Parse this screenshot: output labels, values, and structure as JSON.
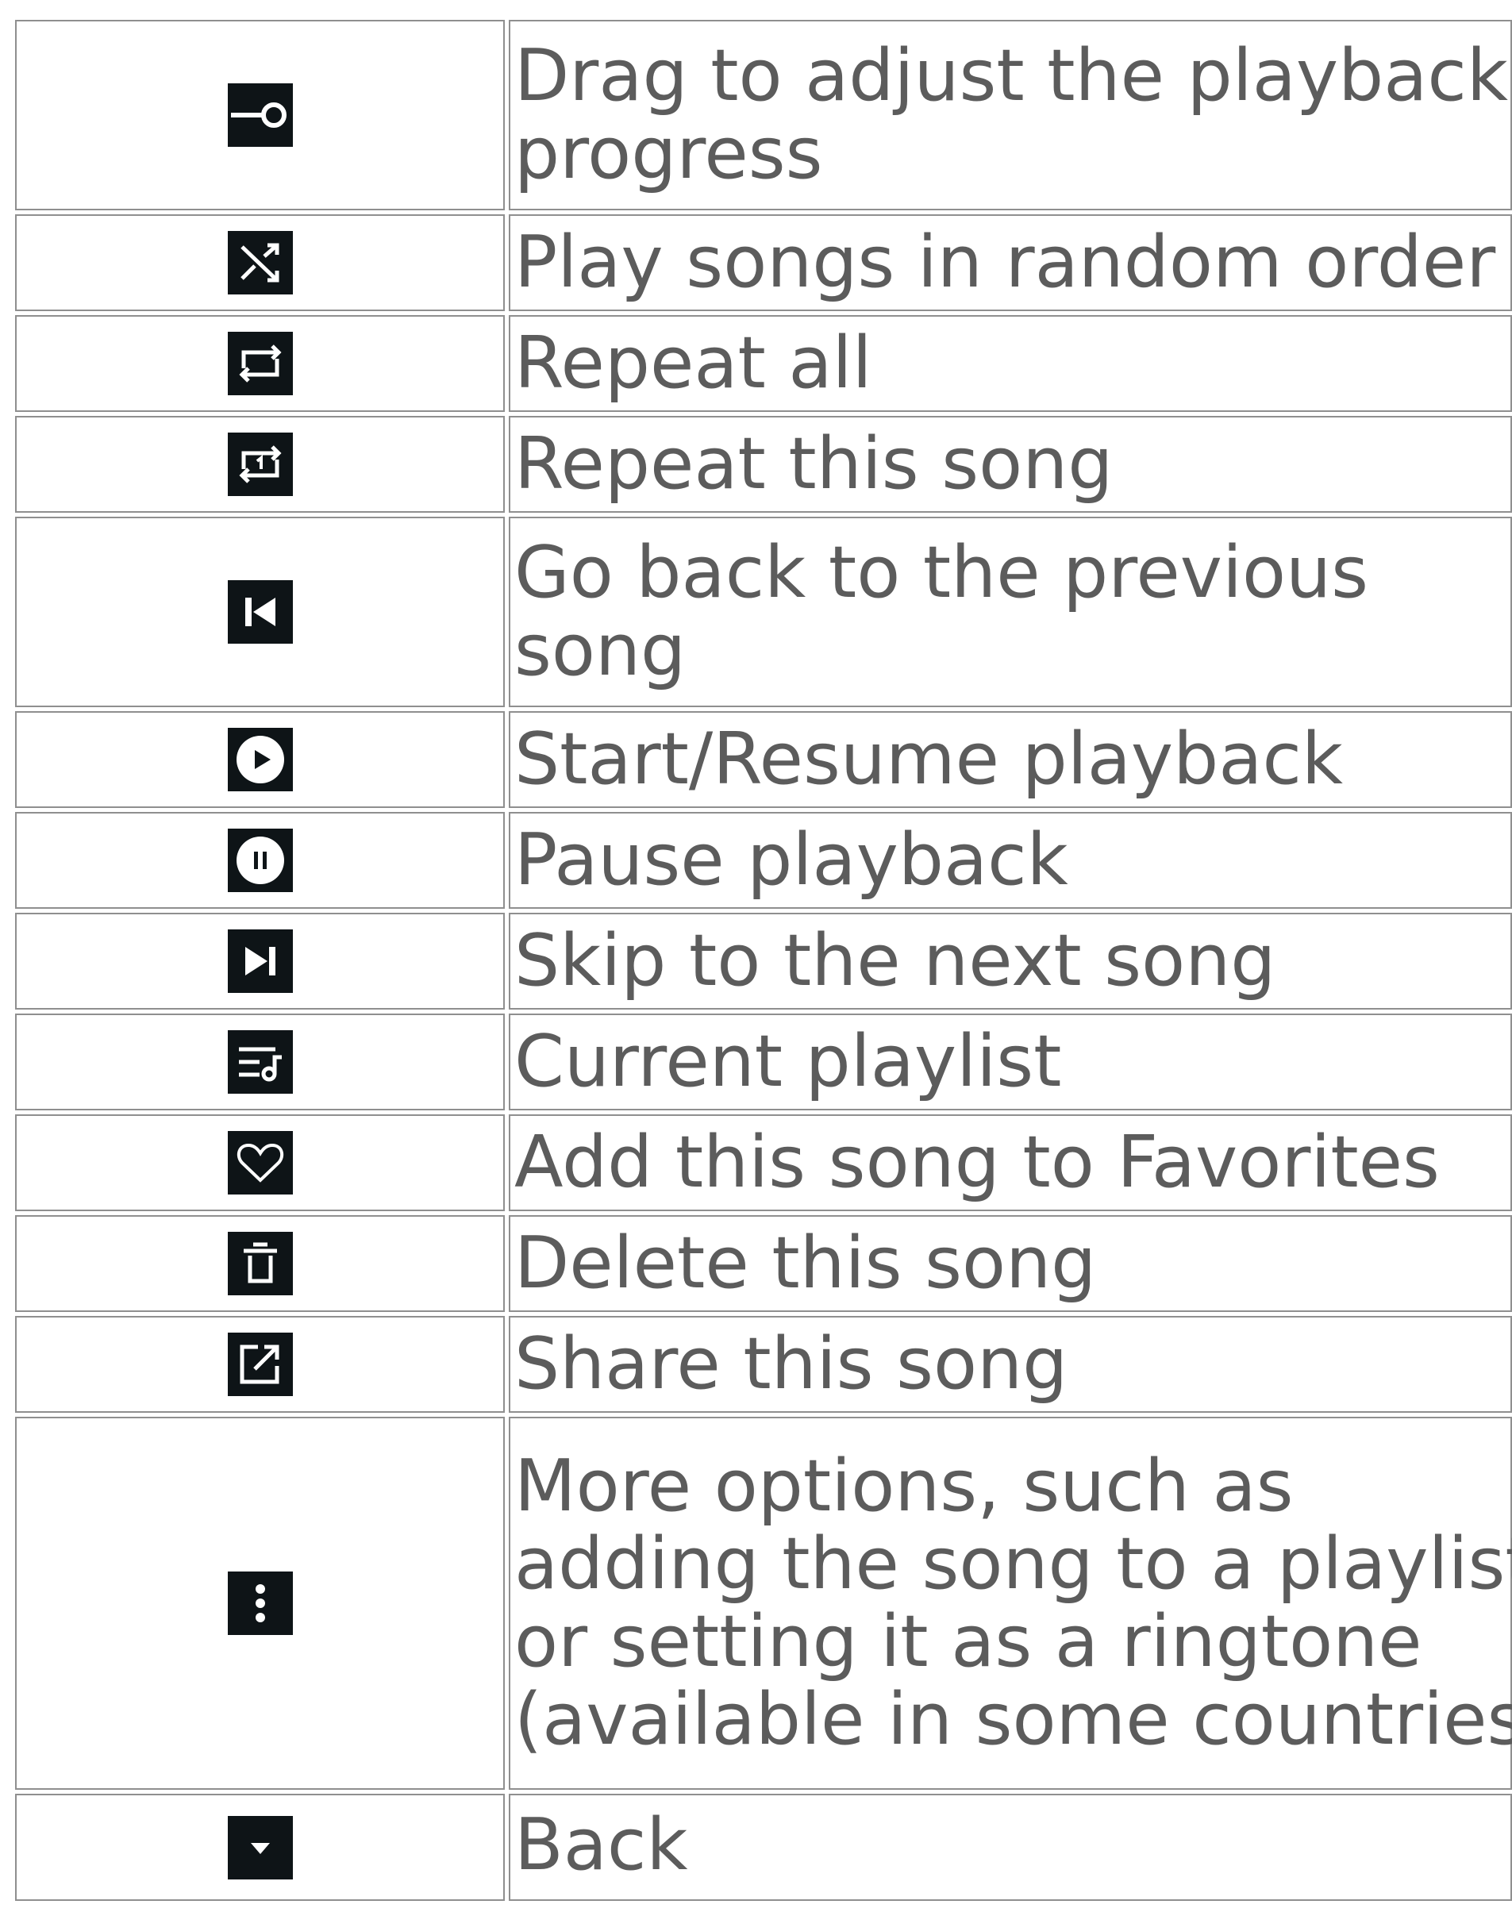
{
  "rows": [
    {
      "icon": "progress-slider-icon",
      "text": "Drag to adjust the playback\nprogress"
    },
    {
      "icon": "shuffle-icon",
      "text": "Play songs in random order"
    },
    {
      "icon": "repeat-all-icon",
      "text": "Repeat all"
    },
    {
      "icon": "repeat-one-icon",
      "text": "Repeat this song"
    },
    {
      "icon": "previous-icon",
      "text": "Go back to the previous\nsong"
    },
    {
      "icon": "play-icon",
      "text": "Start/Resume playback"
    },
    {
      "icon": "pause-icon",
      "text": "Pause playback"
    },
    {
      "icon": "next-icon",
      "text": "Skip to the next song"
    },
    {
      "icon": "playlist-icon",
      "text": "Current playlist"
    },
    {
      "icon": "heart-icon",
      "text": "Add this song to Favorites"
    },
    {
      "icon": "delete-icon",
      "text": "Delete this song"
    },
    {
      "icon": "share-icon",
      "text": "Share this song"
    },
    {
      "icon": "more-options-icon",
      "text": "More options, such as\nadding the song to a playlist\nor setting it as a ringtone\n(available in some countries)"
    },
    {
      "icon": "back-icon",
      "text": "Back"
    }
  ]
}
